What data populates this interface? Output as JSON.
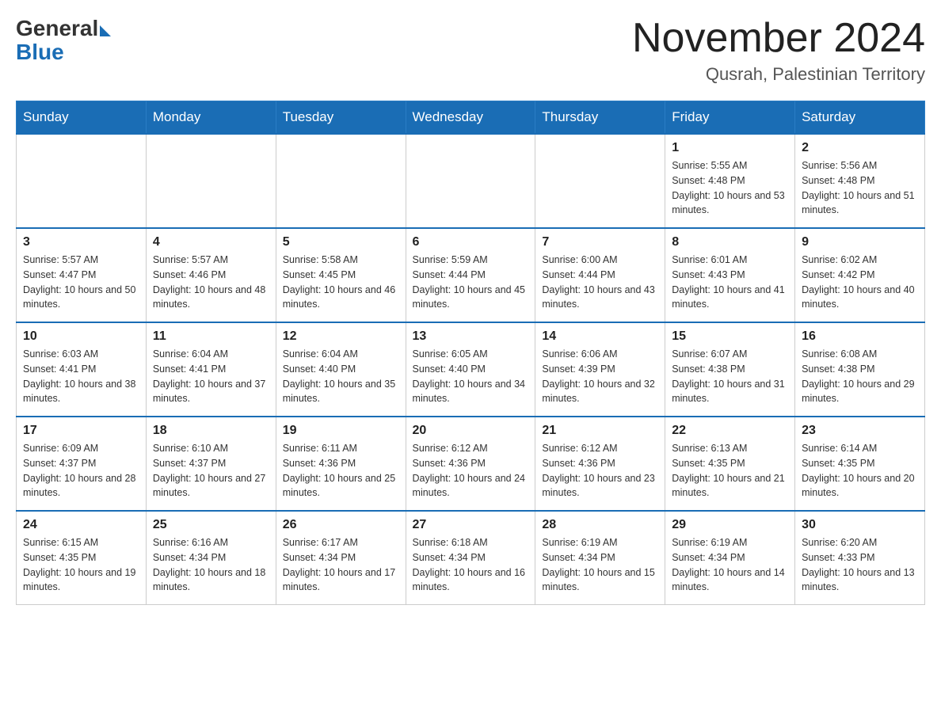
{
  "header": {
    "logo_general": "General",
    "logo_blue": "Blue",
    "month_title": "November 2024",
    "location": "Qusrah, Palestinian Territory"
  },
  "days_of_week": [
    "Sunday",
    "Monday",
    "Tuesday",
    "Wednesday",
    "Thursday",
    "Friday",
    "Saturday"
  ],
  "weeks": [
    [
      {
        "day": "",
        "sunrise": "",
        "sunset": "",
        "daylight": ""
      },
      {
        "day": "",
        "sunrise": "",
        "sunset": "",
        "daylight": ""
      },
      {
        "day": "",
        "sunrise": "",
        "sunset": "",
        "daylight": ""
      },
      {
        "day": "",
        "sunrise": "",
        "sunset": "",
        "daylight": ""
      },
      {
        "day": "",
        "sunrise": "",
        "sunset": "",
        "daylight": ""
      },
      {
        "day": "1",
        "sunrise": "Sunrise: 5:55 AM",
        "sunset": "Sunset: 4:48 PM",
        "daylight": "Daylight: 10 hours and 53 minutes."
      },
      {
        "day": "2",
        "sunrise": "Sunrise: 5:56 AM",
        "sunset": "Sunset: 4:48 PM",
        "daylight": "Daylight: 10 hours and 51 minutes."
      }
    ],
    [
      {
        "day": "3",
        "sunrise": "Sunrise: 5:57 AM",
        "sunset": "Sunset: 4:47 PM",
        "daylight": "Daylight: 10 hours and 50 minutes."
      },
      {
        "day": "4",
        "sunrise": "Sunrise: 5:57 AM",
        "sunset": "Sunset: 4:46 PM",
        "daylight": "Daylight: 10 hours and 48 minutes."
      },
      {
        "day": "5",
        "sunrise": "Sunrise: 5:58 AM",
        "sunset": "Sunset: 4:45 PM",
        "daylight": "Daylight: 10 hours and 46 minutes."
      },
      {
        "day": "6",
        "sunrise": "Sunrise: 5:59 AM",
        "sunset": "Sunset: 4:44 PM",
        "daylight": "Daylight: 10 hours and 45 minutes."
      },
      {
        "day": "7",
        "sunrise": "Sunrise: 6:00 AM",
        "sunset": "Sunset: 4:44 PM",
        "daylight": "Daylight: 10 hours and 43 minutes."
      },
      {
        "day": "8",
        "sunrise": "Sunrise: 6:01 AM",
        "sunset": "Sunset: 4:43 PM",
        "daylight": "Daylight: 10 hours and 41 minutes."
      },
      {
        "day": "9",
        "sunrise": "Sunrise: 6:02 AM",
        "sunset": "Sunset: 4:42 PM",
        "daylight": "Daylight: 10 hours and 40 minutes."
      }
    ],
    [
      {
        "day": "10",
        "sunrise": "Sunrise: 6:03 AM",
        "sunset": "Sunset: 4:41 PM",
        "daylight": "Daylight: 10 hours and 38 minutes."
      },
      {
        "day": "11",
        "sunrise": "Sunrise: 6:04 AM",
        "sunset": "Sunset: 4:41 PM",
        "daylight": "Daylight: 10 hours and 37 minutes."
      },
      {
        "day": "12",
        "sunrise": "Sunrise: 6:04 AM",
        "sunset": "Sunset: 4:40 PM",
        "daylight": "Daylight: 10 hours and 35 minutes."
      },
      {
        "day": "13",
        "sunrise": "Sunrise: 6:05 AM",
        "sunset": "Sunset: 4:40 PM",
        "daylight": "Daylight: 10 hours and 34 minutes."
      },
      {
        "day": "14",
        "sunrise": "Sunrise: 6:06 AM",
        "sunset": "Sunset: 4:39 PM",
        "daylight": "Daylight: 10 hours and 32 minutes."
      },
      {
        "day": "15",
        "sunrise": "Sunrise: 6:07 AM",
        "sunset": "Sunset: 4:38 PM",
        "daylight": "Daylight: 10 hours and 31 minutes."
      },
      {
        "day": "16",
        "sunrise": "Sunrise: 6:08 AM",
        "sunset": "Sunset: 4:38 PM",
        "daylight": "Daylight: 10 hours and 29 minutes."
      }
    ],
    [
      {
        "day": "17",
        "sunrise": "Sunrise: 6:09 AM",
        "sunset": "Sunset: 4:37 PM",
        "daylight": "Daylight: 10 hours and 28 minutes."
      },
      {
        "day": "18",
        "sunrise": "Sunrise: 6:10 AM",
        "sunset": "Sunset: 4:37 PM",
        "daylight": "Daylight: 10 hours and 27 minutes."
      },
      {
        "day": "19",
        "sunrise": "Sunrise: 6:11 AM",
        "sunset": "Sunset: 4:36 PM",
        "daylight": "Daylight: 10 hours and 25 minutes."
      },
      {
        "day": "20",
        "sunrise": "Sunrise: 6:12 AM",
        "sunset": "Sunset: 4:36 PM",
        "daylight": "Daylight: 10 hours and 24 minutes."
      },
      {
        "day": "21",
        "sunrise": "Sunrise: 6:12 AM",
        "sunset": "Sunset: 4:36 PM",
        "daylight": "Daylight: 10 hours and 23 minutes."
      },
      {
        "day": "22",
        "sunrise": "Sunrise: 6:13 AM",
        "sunset": "Sunset: 4:35 PM",
        "daylight": "Daylight: 10 hours and 21 minutes."
      },
      {
        "day": "23",
        "sunrise": "Sunrise: 6:14 AM",
        "sunset": "Sunset: 4:35 PM",
        "daylight": "Daylight: 10 hours and 20 minutes."
      }
    ],
    [
      {
        "day": "24",
        "sunrise": "Sunrise: 6:15 AM",
        "sunset": "Sunset: 4:35 PM",
        "daylight": "Daylight: 10 hours and 19 minutes."
      },
      {
        "day": "25",
        "sunrise": "Sunrise: 6:16 AM",
        "sunset": "Sunset: 4:34 PM",
        "daylight": "Daylight: 10 hours and 18 minutes."
      },
      {
        "day": "26",
        "sunrise": "Sunrise: 6:17 AM",
        "sunset": "Sunset: 4:34 PM",
        "daylight": "Daylight: 10 hours and 17 minutes."
      },
      {
        "day": "27",
        "sunrise": "Sunrise: 6:18 AM",
        "sunset": "Sunset: 4:34 PM",
        "daylight": "Daylight: 10 hours and 16 minutes."
      },
      {
        "day": "28",
        "sunrise": "Sunrise: 6:19 AM",
        "sunset": "Sunset: 4:34 PM",
        "daylight": "Daylight: 10 hours and 15 minutes."
      },
      {
        "day": "29",
        "sunrise": "Sunrise: 6:19 AM",
        "sunset": "Sunset: 4:34 PM",
        "daylight": "Daylight: 10 hours and 14 minutes."
      },
      {
        "day": "30",
        "sunrise": "Sunrise: 6:20 AM",
        "sunset": "Sunset: 4:33 PM",
        "daylight": "Daylight: 10 hours and 13 minutes."
      }
    ]
  ]
}
